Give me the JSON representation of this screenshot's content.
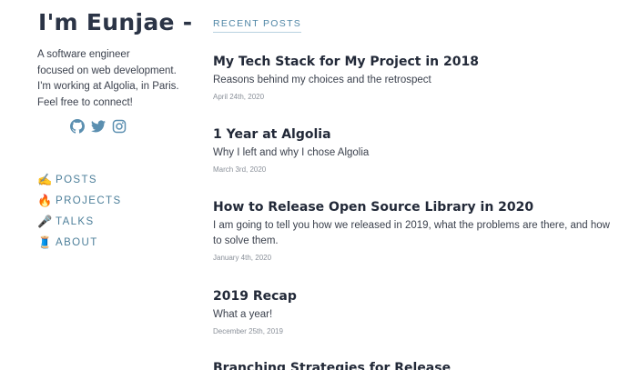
{
  "sidebar": {
    "title": "I'm Eunjae -",
    "bio": [
      "A software engineer",
      "focused on web development.",
      "I'm working at Algolia, in Paris.",
      "Feel free to connect!"
    ],
    "social": [
      {
        "icon": "github-icon"
      },
      {
        "icon": "twitter-icon"
      },
      {
        "icon": "instagram-icon"
      }
    ],
    "nav": [
      {
        "emoji": "✍️",
        "label": "POSTS"
      },
      {
        "emoji": "🔥",
        "label": "PROJECTS"
      },
      {
        "emoji": "🎤",
        "label": "TALKS"
      },
      {
        "emoji": "🧵",
        "label": "ABOUT"
      }
    ]
  },
  "main": {
    "heading": "RECENT POSTS",
    "posts": [
      {
        "title": "My Tech Stack for My Project in 2018",
        "description": "Reasons behind my choices and the retrospect",
        "date": "April 24th, 2020"
      },
      {
        "title": "1 Year at Algolia",
        "description": "Why I left and why I chose Algolia",
        "date": "March 3rd, 2020"
      },
      {
        "title": "How to Release Open Source Library in 2020",
        "description": "I am going to tell you how we released in 2019, what the problems are there, and how to solve them.",
        "date": "January 4th, 2020"
      },
      {
        "title": "2019 Recap",
        "description": "What a year!",
        "date": "December 25th, 2019"
      },
      {
        "title": "Branching Strategies for Release",
        "description": "",
        "date": ""
      }
    ]
  },
  "colors": {
    "nav_link": "#4d7f9a",
    "icon": "#5b8fb0",
    "title": "#2b3446"
  }
}
